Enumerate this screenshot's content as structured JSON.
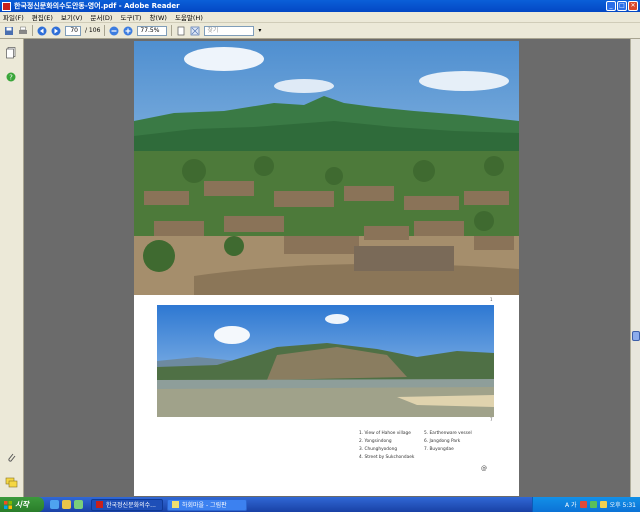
{
  "window": {
    "title": "한국정신문화의수도안동-영어.pdf - Adobe Reader",
    "buttons": [
      "_",
      "□",
      "✕"
    ]
  },
  "menu": [
    "파일(F)",
    "편집(E)",
    "보기(V)",
    "문서(D)",
    "도구(T)",
    "창(W)",
    "도움말(H)"
  ],
  "toolbar": {
    "page_current": "70",
    "page_total": "/ 106",
    "zoom": "77.5%",
    "search_placeholder": "찾기"
  },
  "document": {
    "page_number_top": "1",
    "page_number_bottom": "7",
    "captions": [
      "1. View of Hahoe village",
      "5. Earthenware vessel",
      "2. Yongsindong",
      "6. Jangdong Park",
      "3. Chunghyodong",
      "7. Buyongdae",
      "4. Street by Sukchondaek",
      ""
    ],
    "logo": "@"
  },
  "taskbar": {
    "start": "시작",
    "tasks": [
      "한국정신문화의수...",
      "하회마을 - 그림판"
    ],
    "tray_lang": "A 가",
    "clock": "오후 5:31"
  },
  "colors": {
    "titlebar": "#0347c4",
    "chrome": "#ece9d8",
    "workspace": "#6b6b6b",
    "taskbar": "#1941a5",
    "start": "#2a7d2a"
  }
}
